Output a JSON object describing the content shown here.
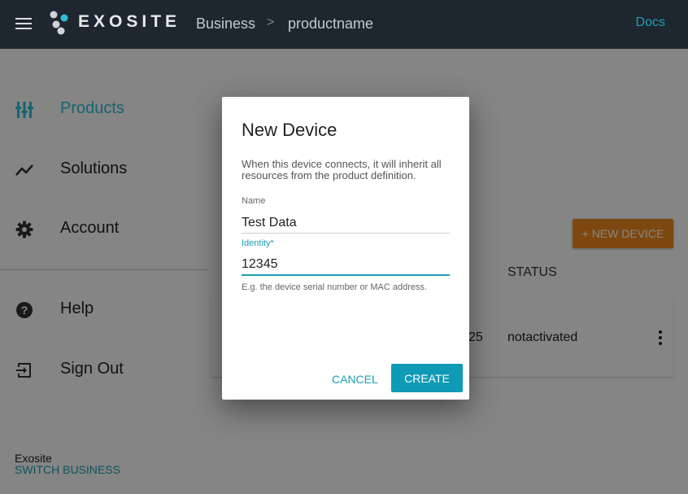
{
  "header": {
    "menu_icon": "hamburger-icon",
    "logo_icon": "exosite-logo-mark",
    "brand": "EXOSITE",
    "breadcrumb": [
      "Business",
      "productname"
    ],
    "breadcrumb_separator": ">",
    "docs_link": "Docs"
  },
  "sidebar": {
    "items": [
      {
        "label": "Products",
        "icon": "products-icon",
        "active": true
      },
      {
        "label": "Solutions",
        "icon": "trending-icon",
        "active": false
      },
      {
        "label": "Account",
        "icon": "gear-icon",
        "active": false
      },
      {
        "label": "Help",
        "icon": "help-icon",
        "active": false
      },
      {
        "label": "Sign Out",
        "icon": "sign-out-icon",
        "active": false
      }
    ],
    "footer": {
      "business": "Exosite",
      "switch_label": "SWITCH BUSINESS"
    }
  },
  "main": {
    "new_device_button": "+ NEW DEVICE",
    "table": {
      "status_header": "STATUS",
      "row": {
        "partial_id": "25",
        "status": "notactivated"
      }
    }
  },
  "dialog": {
    "title": "New Device",
    "description": "When this device connects, it will inherit all resources from the product definition.",
    "name_label": "Name",
    "name_value": "Test Data",
    "identity_label": "Identity*",
    "identity_value": "12345",
    "identity_help": "E.g. the device serial number or MAC address.",
    "cancel_label": "CANCEL",
    "create_label": "CREATE"
  },
  "colors": {
    "header_bg": "#1e2630",
    "accent": "#1d9fb3",
    "primary_button": "#0f9ab5",
    "new_device_button": "#ef8a1f",
    "active_nav": "#2cc0d8"
  }
}
